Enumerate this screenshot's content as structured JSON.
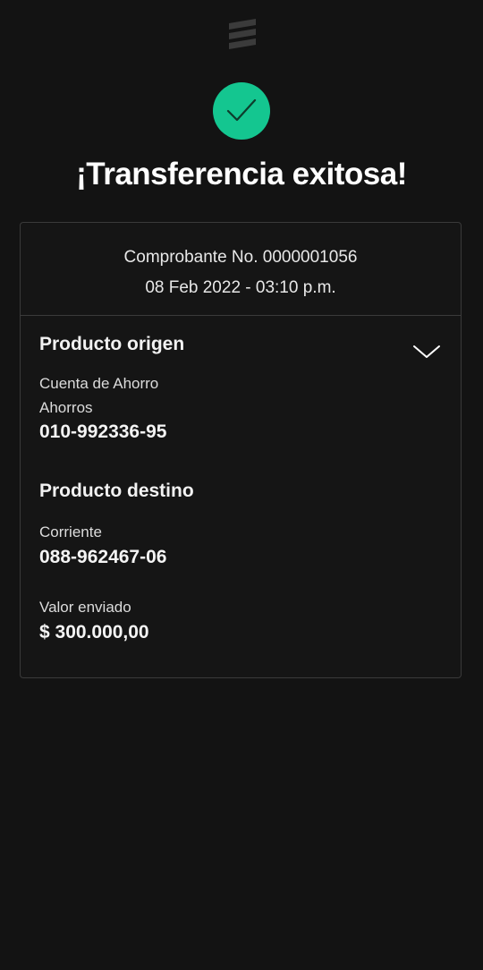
{
  "header": {
    "logo_icon": "bank-logo-icon",
    "status_icon": "checkmark-circle-icon",
    "status_color": "#14c690",
    "title": "¡Transferencia exitosa!"
  },
  "receipt": {
    "number_line": "Comprobante No. 0000001056",
    "datetime_line": "08 Feb 2022 - 03:10 p.m."
  },
  "origin": {
    "title": "Producto origen",
    "account_type": "Cuenta de Ahorro",
    "account_subtype": "Ahorros",
    "account_number": "010-992336-95",
    "toggle_icon": "chevron-down-icon"
  },
  "destination": {
    "title": "Producto destino",
    "account_type": "Corriente",
    "account_number": "088-962467-06"
  },
  "amount": {
    "label": "Valor enviado",
    "value": "$ 300.000,00"
  }
}
